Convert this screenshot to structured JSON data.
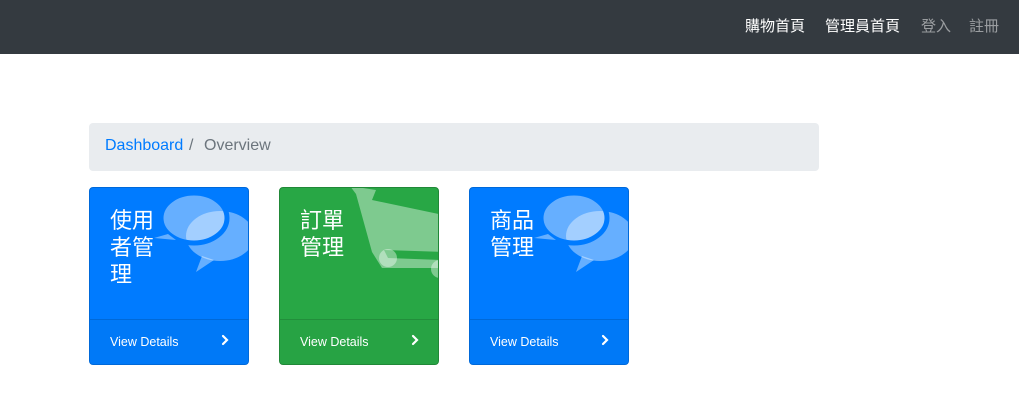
{
  "nav": {
    "items": [
      {
        "label": "購物首頁",
        "state": "active"
      },
      {
        "label": "管理員首頁",
        "state": "active"
      },
      {
        "label": "登入",
        "state": "muted"
      },
      {
        "label": "註冊",
        "state": "muted"
      }
    ]
  },
  "breadcrumb": {
    "link": "Dashboard",
    "separator": "/",
    "current": "Overview"
  },
  "cards": [
    {
      "title": "使用者管理",
      "footer": "View Details",
      "icon": "comments-icon",
      "color": "#007bff"
    },
    {
      "title": "訂單管理",
      "footer": "View Details",
      "icon": "shopping-cart-icon",
      "color": "#28a745"
    },
    {
      "title": "商品管理",
      "footer": "View Details",
      "icon": "comments-icon",
      "color": "#007bff"
    }
  ]
}
